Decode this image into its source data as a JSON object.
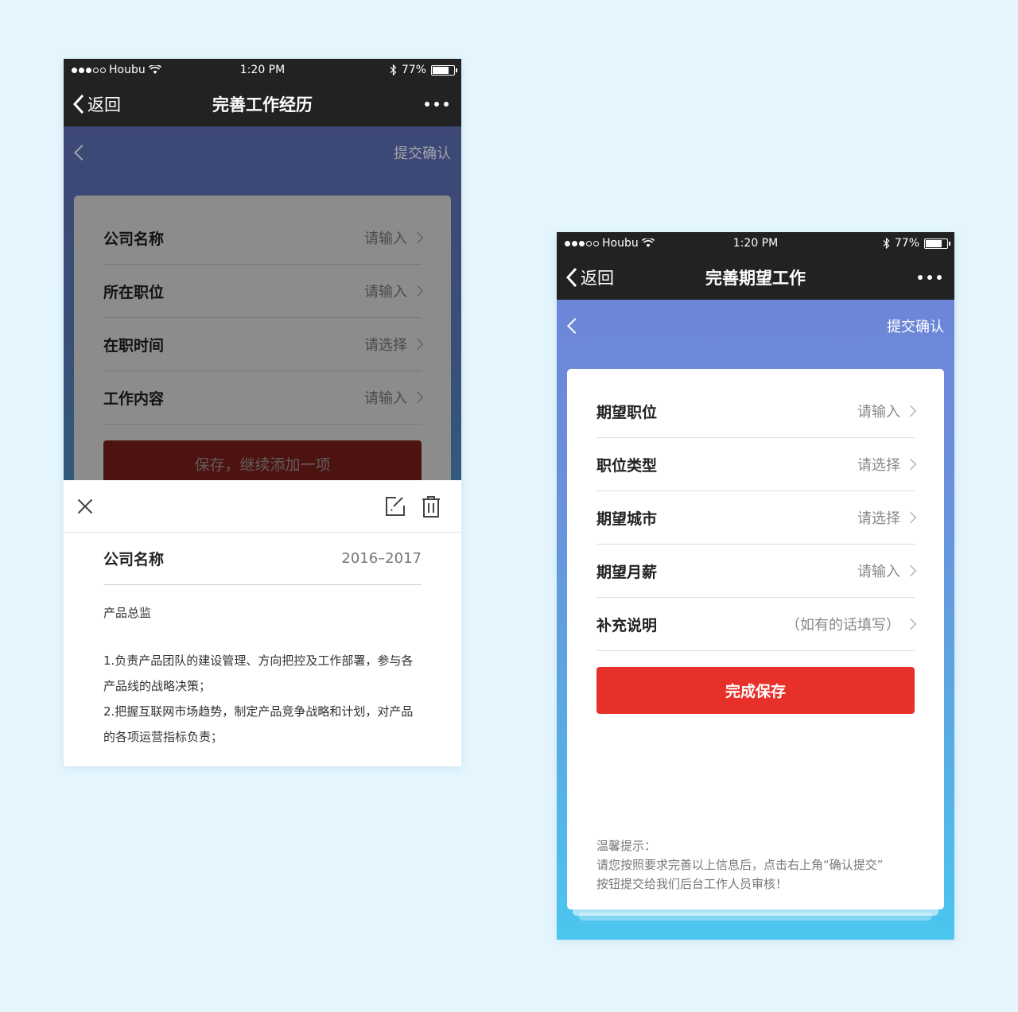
{
  "status": {
    "carrier": "Houbu",
    "time": "1:20 PM",
    "battery": "77%",
    "battery_level": 0.77
  },
  "left": {
    "nav": {
      "back": "返回",
      "title": "完善工作经历"
    },
    "subbar": {
      "submit": "提交确认"
    },
    "rows": [
      {
        "label": "公司名称",
        "value": "请输入"
      },
      {
        "label": "所在职位",
        "value": "请输入"
      },
      {
        "label": "在职时间",
        "value": "请选择"
      },
      {
        "label": "工作内容",
        "value": "请输入"
      }
    ],
    "button": "保存，继续添加一项",
    "sheet": {
      "company": "公司名称",
      "years": "2016–2017",
      "position": "产品总监",
      "desc_line1": "1.负责产品团队的建设管理、方向把控及工作部署，参与各",
      "desc_line2": "产品线的战略决策；",
      "desc_line3": "2.把握互联网市场趋势，制定产品竞争战略和计划，对产品",
      "desc_line4": "的各项运营指标负责；"
    }
  },
  "right": {
    "nav": {
      "back": "返回",
      "title": "完善期望工作"
    },
    "subbar": {
      "submit": "提交确认"
    },
    "rows": [
      {
        "label": "期望职位",
        "value": "请输入"
      },
      {
        "label": "职位类型",
        "value": "请选择"
      },
      {
        "label": "期望城市",
        "value": "请选择"
      },
      {
        "label": "期望月薪",
        "value": "请输入"
      },
      {
        "label": "补充说明",
        "value": "（如有的话填写）"
      }
    ],
    "button": "完成保存",
    "tip": {
      "title": "温馨提示：",
      "line1": "请您按照要求完善以上信息后，点击右上角“确认提交”",
      "line2": "按钮提交给我们后台工作人员审核！"
    }
  },
  "colors": {
    "accent_red": "#e8302a",
    "nav_bg": "#222222",
    "gradient_top": "#6e82d6",
    "gradient_bottom": "#4bc6ef"
  }
}
